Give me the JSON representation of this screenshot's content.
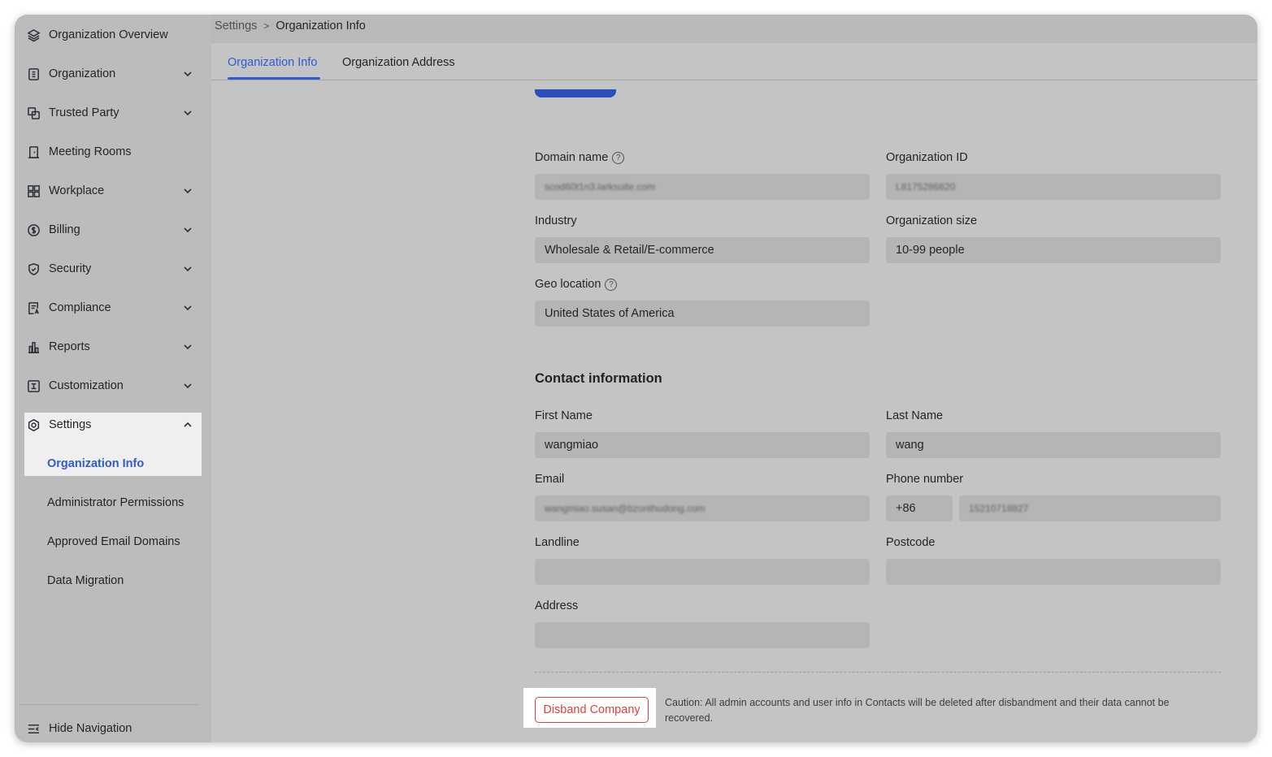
{
  "sidebar": {
    "items": [
      {
        "label": "Organization Overview",
        "icon": "layers-icon",
        "has_chevron": false
      },
      {
        "label": "Organization",
        "icon": "org-badge-icon",
        "has_chevron": true
      },
      {
        "label": "Trusted Party",
        "icon": "linked-squares-icon",
        "has_chevron": true
      },
      {
        "label": "Meeting Rooms",
        "icon": "door-icon",
        "has_chevron": false
      },
      {
        "label": "Workplace",
        "icon": "grid-icon",
        "has_chevron": true
      },
      {
        "label": "Billing",
        "icon": "dollar-icon",
        "has_chevron": true
      },
      {
        "label": "Security",
        "icon": "shield-icon",
        "has_chevron": true
      },
      {
        "label": "Compliance",
        "icon": "document-icon",
        "has_chevron": true
      },
      {
        "label": "Reports",
        "icon": "bar-chart-icon",
        "has_chevron": true
      },
      {
        "label": "Customization",
        "icon": "customize-icon",
        "has_chevron": true
      }
    ],
    "settings": {
      "label": "Settings",
      "icon": "gear-icon",
      "expanded": true,
      "children": [
        {
          "label": "Organization Info",
          "active": true
        },
        {
          "label": "Administrator Permissions",
          "active": false
        },
        {
          "label": "Approved Email Domains",
          "active": false
        },
        {
          "label": "Data Migration",
          "active": false
        }
      ]
    },
    "hide_navigation": "Hide Navigation"
  },
  "breadcrumb": {
    "parent": "Settings",
    "separator": ">",
    "current": "Organization Info"
  },
  "tabs": [
    {
      "label": "Organization Info",
      "active": true
    },
    {
      "label": "Organization Address",
      "active": false
    }
  ],
  "form": {
    "domain_name": {
      "label": "Domain name",
      "value": "scod60t1n3.larksuite.com"
    },
    "organization_id": {
      "label": "Organization ID",
      "value": "L8175286620"
    },
    "industry": {
      "label": "Industry",
      "value": "Wholesale & Retail/E-commerce"
    },
    "organization_size": {
      "label": "Organization size",
      "value": "10-99 people"
    },
    "geo_location": {
      "label": "Geo location",
      "value": "United States of America"
    }
  },
  "contact": {
    "title": "Contact information",
    "first_name": {
      "label": "First Name",
      "value": "wangmiao"
    },
    "last_name": {
      "label": "Last Name",
      "value": "wang"
    },
    "email": {
      "label": "Email",
      "value": "wangmiao.susan@bzonthudong.com"
    },
    "phone": {
      "label": "Phone number",
      "country_code": "+86",
      "value": "15210718827"
    },
    "landline": {
      "label": "Landline",
      "value": ""
    },
    "postcode": {
      "label": "Postcode",
      "value": ""
    },
    "address": {
      "label": "Address",
      "value": ""
    }
  },
  "danger": {
    "button_label": "Disband Company",
    "caution": "Caution: All admin accounts and user info in Contacts will be deleted after disbandment and their data cannot be recovered."
  },
  "colors": {
    "accent": "#2f5ad6",
    "danger": "#e0403a"
  }
}
